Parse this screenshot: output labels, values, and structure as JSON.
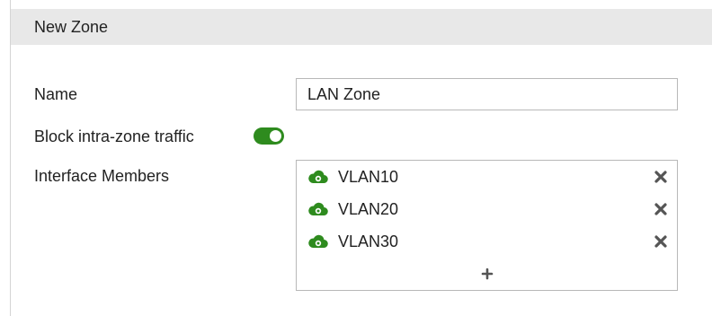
{
  "dialog": {
    "title": "New Zone"
  },
  "form": {
    "name_label": "Name",
    "name_value": "LAN Zone",
    "block_label": "Block intra-zone traffic",
    "block_enabled": true,
    "members_label": "Interface Members",
    "members": [
      {
        "label": "VLAN10",
        "icon": "cloud-network-icon"
      },
      {
        "label": "VLAN20",
        "icon": "cloud-network-icon"
      },
      {
        "label": "VLAN30",
        "icon": "cloud-network-icon"
      }
    ],
    "remove_icon": "close-x-icon",
    "add_icon": "plus-icon"
  },
  "colors": {
    "header_bg": "#e8e8e8",
    "toggle_on": "#2e8b1e",
    "icon_green": "#2e8b1e",
    "remove_gray": "#555555"
  }
}
